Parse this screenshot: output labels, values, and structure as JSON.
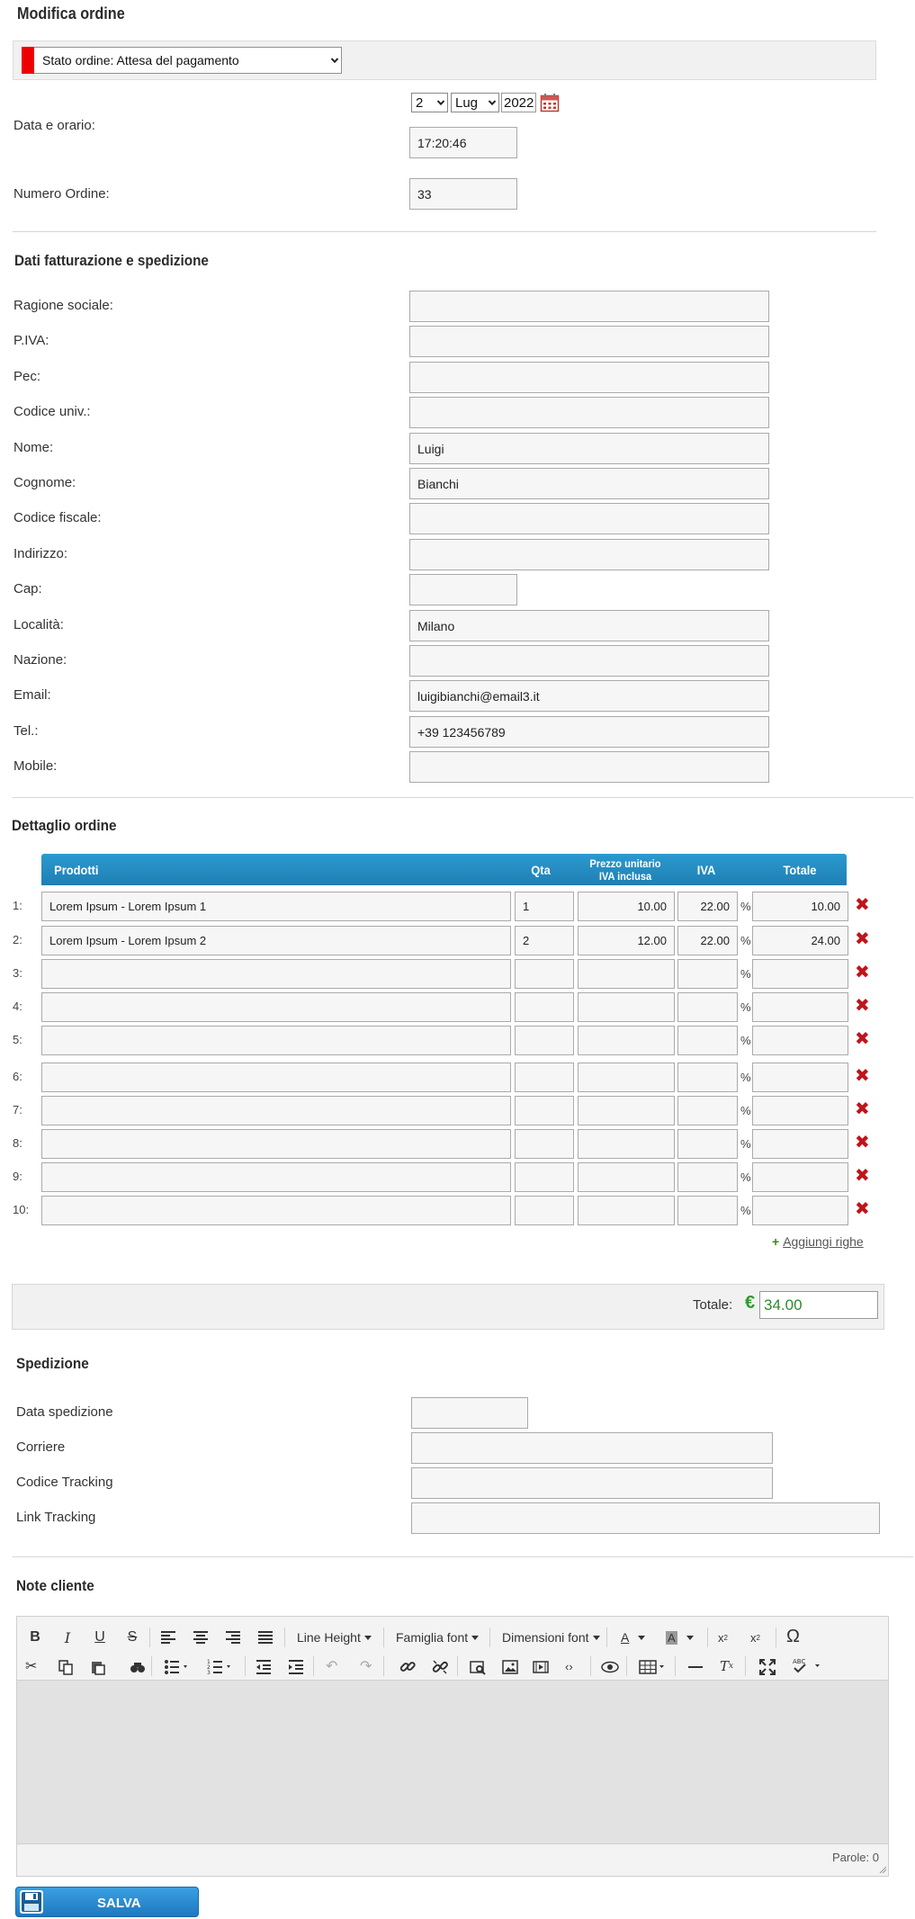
{
  "page_title": "Modifica ordine",
  "status": {
    "label": "Stato ordine: Attesa del pagamento",
    "color": "#ee0000"
  },
  "date_section": {
    "label": "Data e orario:",
    "day": "2",
    "month": "Lug",
    "year": "2022",
    "time": "17:20:46"
  },
  "order_number": {
    "label": "Numero Ordine:",
    "value": "33"
  },
  "billing": {
    "title": "Dati fatturazione e spedizione",
    "fields": [
      {
        "label": "Ragione sociale:",
        "value": ""
      },
      {
        "label": "P.IVA:",
        "value": ""
      },
      {
        "label": "Pec:",
        "value": ""
      },
      {
        "label": "Codice univ.:",
        "value": ""
      },
      {
        "label": "Nome:",
        "value": "Luigi"
      },
      {
        "label": "Cognome:",
        "value": "Bianchi"
      },
      {
        "label": "Codice fiscale:",
        "value": ""
      },
      {
        "label": "Indirizzo:",
        "value": ""
      },
      {
        "label": "Cap:",
        "value": ""
      },
      {
        "label": "Località:",
        "value": "Milano"
      },
      {
        "label": "Nazione:",
        "value": ""
      },
      {
        "label": "Email:",
        "value": "luigibianchi@email3.it"
      },
      {
        "label": "Tel.:",
        "value": "+39 123456789"
      },
      {
        "label": "Mobile:",
        "value": ""
      }
    ]
  },
  "order_detail": {
    "title": "Dettaglio ordine",
    "headers": {
      "product": "Prodotti",
      "qty": "Qta",
      "unit_price_1": "Prezzo unitario",
      "unit_price_2": "IVA inclusa",
      "vat": "IVA",
      "total": "Totale"
    },
    "rows": [
      {
        "num": "1:",
        "product": "Lorem Ipsum - Lorem Ipsum 1",
        "qty": "1",
        "price": "10.00",
        "vat": "22.00",
        "pct": "%",
        "total": "10.00"
      },
      {
        "num": "2:",
        "product": "Lorem Ipsum - Lorem Ipsum 2",
        "qty": "2",
        "price": "12.00",
        "vat": "22.00",
        "pct": "%",
        "total": "24.00"
      },
      {
        "num": "3:",
        "product": "",
        "qty": "",
        "price": "",
        "vat": "",
        "pct": "%",
        "total": ""
      },
      {
        "num": "4:",
        "product": "",
        "qty": "",
        "price": "",
        "vat": "",
        "pct": "%",
        "total": ""
      },
      {
        "num": "5:",
        "product": "",
        "qty": "",
        "price": "",
        "vat": "",
        "pct": "%",
        "total": ""
      },
      {
        "num": "6:",
        "product": "",
        "qty": "",
        "price": "",
        "vat": "",
        "pct": "%",
        "total": ""
      },
      {
        "num": "7:",
        "product": "",
        "qty": "",
        "price": "",
        "vat": "",
        "pct": "%",
        "total": ""
      },
      {
        "num": "8:",
        "product": "",
        "qty": "",
        "price": "",
        "vat": "",
        "pct": "%",
        "total": ""
      },
      {
        "num": "9:",
        "product": "",
        "qty": "",
        "price": "",
        "vat": "",
        "pct": "%",
        "total": ""
      },
      {
        "num": "10:",
        "product": "",
        "qty": "",
        "price": "",
        "vat": "",
        "pct": "%",
        "total": ""
      }
    ],
    "add_rows": "Aggiungi righe",
    "add_rows_icon": "plus-icon",
    "delete_icon": "delete-x-icon"
  },
  "totals": {
    "label": "Totale:",
    "currency": "€",
    "value": "34.00"
  },
  "shipping": {
    "title": "Spedizione",
    "fields": [
      {
        "label": "Data spedizione",
        "value": ""
      },
      {
        "label": "Corriere",
        "value": ""
      },
      {
        "label": "Codice Tracking",
        "value": ""
      },
      {
        "label": "Link Tracking",
        "value": ""
      }
    ]
  },
  "notes": {
    "title": "Note cliente",
    "toolbar": {
      "line_height": "Line Height",
      "font_family": "Famiglia font",
      "font_size": "Dimensioni font"
    },
    "word_count": "Parole: 0"
  },
  "save_button": {
    "label": "SALVA"
  }
}
